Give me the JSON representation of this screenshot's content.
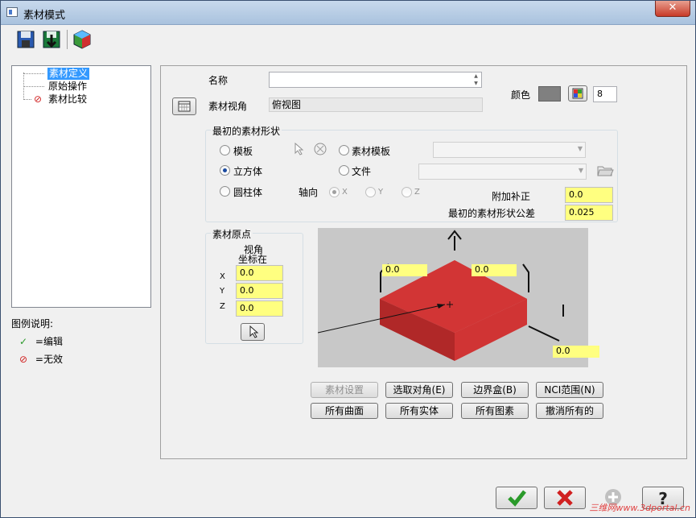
{
  "window": {
    "title": "素材模式",
    "close_label": "✕"
  },
  "toolbar": {
    "icons": [
      "save-icon",
      "load-icon",
      "stock-shape-icon"
    ]
  },
  "tree": {
    "items": [
      {
        "label": "素材定义",
        "selected": true,
        "status": "none"
      },
      {
        "label": "原始操作",
        "selected": false,
        "status": "none"
      },
      {
        "label": "素材比较",
        "selected": false,
        "status": "invalid"
      }
    ]
  },
  "legend": {
    "title": "图例说明:",
    "items": [
      {
        "symbol": "✓",
        "label": "=编辑",
        "color": "#2a9a2a"
      },
      {
        "symbol": "⊘",
        "label": "=无效",
        "color": "#d02020"
      }
    ]
  },
  "form": {
    "name_label": "名称",
    "name_value": "",
    "view_label": "素材视角",
    "view_value": "俯视图",
    "color_label": "颜色",
    "color_swatch": "#808080",
    "color_number": "8"
  },
  "initial_shape": {
    "title": "最初的素材形状",
    "template": "模板",
    "block": "立方体",
    "cylinder": "圆柱体",
    "stock_template": "素材模板",
    "file": "文件",
    "axis_label": "轴向",
    "axis_x": "X",
    "axis_y": "Y",
    "axis_z": "Z",
    "selected_shape": "立方体",
    "extra_label": "附加补正",
    "extra_value": "0.0",
    "tol_label": "最初的素材形状公差",
    "tol_value": "0.025"
  },
  "origin": {
    "title": "素材原点",
    "view_line1": "视角",
    "view_line2": "坐标在",
    "x_label": "X",
    "x_value": "0.0",
    "y_label": "Y",
    "y_value": "0.0",
    "z_label": "Z",
    "z_value": "0.0"
  },
  "preview": {
    "fields": [
      "0.0",
      "0.0",
      "0.0"
    ],
    "box_color": "#d03030"
  },
  "buttons": {
    "stock_setup": "素材设置",
    "select_corners": "选取对角(E)",
    "bounding_box": "边界盒(B)",
    "nci_extents": "NCI范围(N)",
    "all_surfaces": "所有曲面",
    "all_solids": "所有实体",
    "all_entities": "所有图素",
    "unselect_all": "撤消所有的"
  },
  "dialog_buttons": {
    "ok": "ok-icon",
    "cancel": "cancel-icon",
    "add": "add-icon",
    "help": "help-icon"
  },
  "watermark": "三维网www.3dportal.cn"
}
